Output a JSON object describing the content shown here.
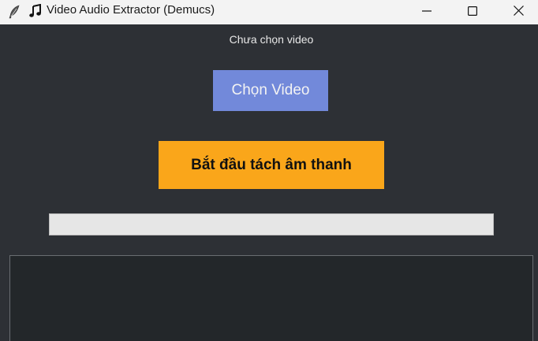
{
  "window": {
    "title": "Video Audio Extractor (Demucs)",
    "app_icon": "feather-icon",
    "title_icon": "music-note-icon",
    "controls": {
      "minimize_icon": "minimize-icon",
      "maximize_icon": "maximize-icon",
      "close_icon": "close-icon"
    }
  },
  "main": {
    "status_text": "Chưa chọn video",
    "choose_button_label": "Chọn Video",
    "start_button_label": "Bắt đầu tách âm thanh",
    "progress_fraction": 0,
    "log_text": ""
  },
  "colors": {
    "background": "#2d3035",
    "choose_button": "#7289da",
    "start_button": "#faa61a",
    "log_background": "#23272a",
    "progress_track": "#e6e6e6"
  }
}
